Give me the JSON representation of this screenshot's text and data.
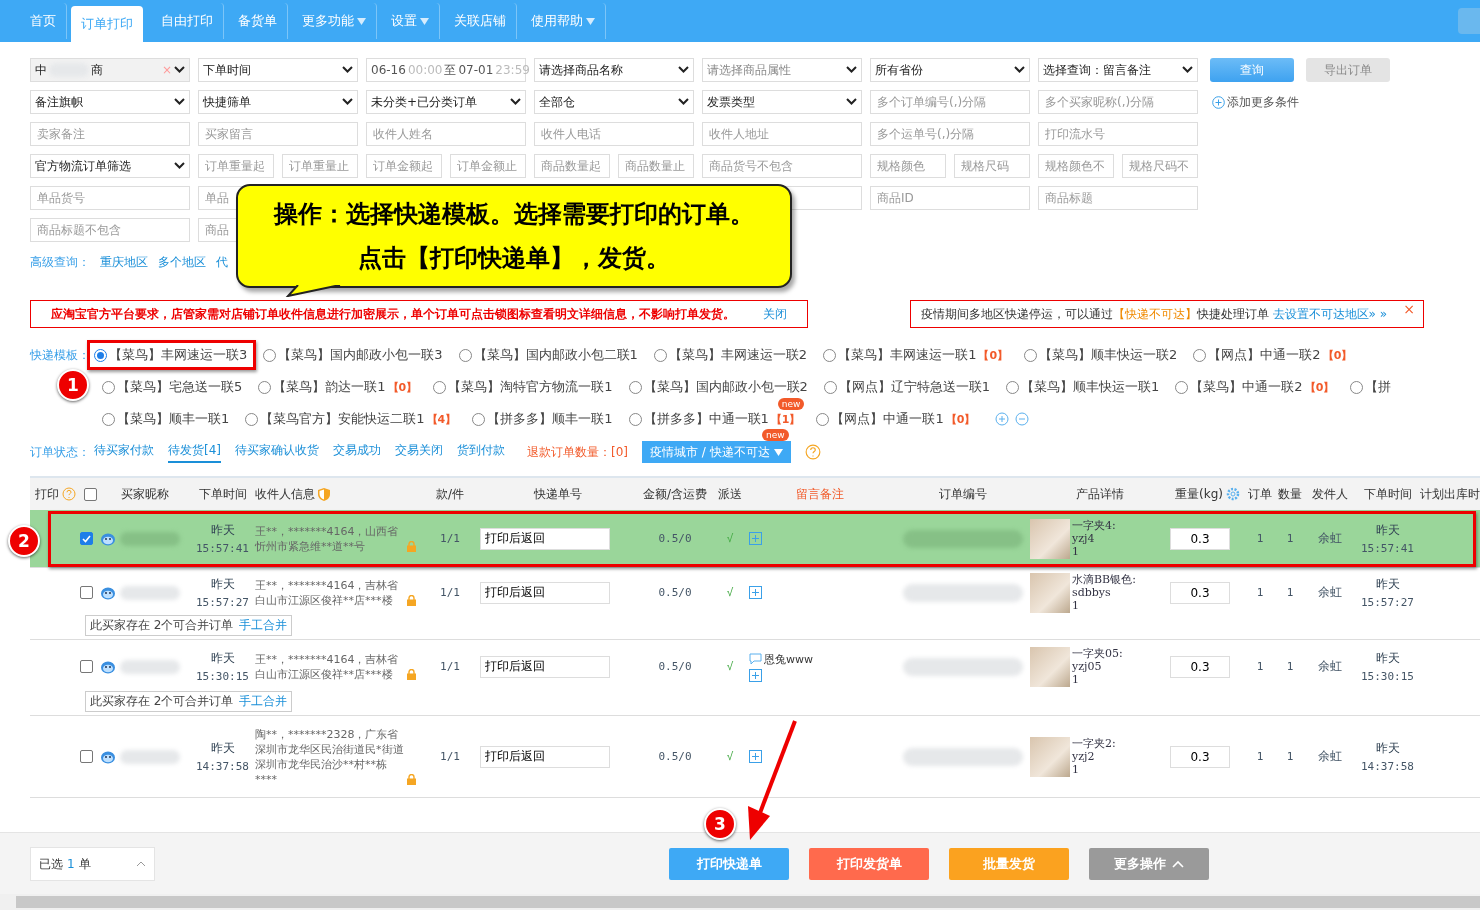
{
  "nav": {
    "tabs": [
      {
        "label": "首页",
        "selected": false,
        "dropdown": false
      },
      {
        "label": "订单打印",
        "selected": true,
        "dropdown": false
      },
      {
        "label": "自由打印",
        "selected": false,
        "dropdown": false
      },
      {
        "label": "备货单",
        "selected": false,
        "dropdown": false
      },
      {
        "label": "更多功能",
        "selected": false,
        "dropdown": true
      },
      {
        "label": "设置",
        "selected": false,
        "dropdown": true
      },
      {
        "label": "关联店铺",
        "selected": false,
        "dropdown": false
      },
      {
        "label": "使用帮助",
        "selected": false,
        "dropdown": true
      }
    ]
  },
  "filters": {
    "rows": [
      [
        {
          "kind": "shop",
          "prefix": "中",
          "suffix": "商",
          "clear": "×"
        },
        {
          "kind": "select",
          "value": "下单时间"
        },
        {
          "kind": "daterange",
          "start_date": "06-16",
          "start_time": "00:00",
          "sep": "至",
          "end_date": "07-01",
          "end_time": "23:59"
        },
        {
          "kind": "select",
          "value": "请选择商品名称"
        },
        {
          "kind": "select",
          "placeholder": "请选择商品属性"
        },
        {
          "kind": "select",
          "value": "所有省份"
        },
        {
          "kind": "select",
          "value": "选择查询：留言备注"
        }
      ],
      [
        {
          "kind": "select",
          "value": "备注旗帜"
        },
        {
          "kind": "select",
          "value": "快捷筛单"
        },
        {
          "kind": "select",
          "value": "未分类+已分类订单"
        },
        {
          "kind": "select",
          "value": "全部仓"
        },
        {
          "kind": "select",
          "value": "发票类型"
        },
        {
          "kind": "input",
          "placeholder": "多个订单编号(,)分隔"
        },
        {
          "kind": "input",
          "placeholder": "多个买家昵称(,)分隔"
        }
      ],
      [
        {
          "kind": "input",
          "placeholder": "卖家备注"
        },
        {
          "kind": "input",
          "placeholder": "买家留言"
        },
        {
          "kind": "input",
          "placeholder": "收件人姓名"
        },
        {
          "kind": "input",
          "placeholder": "收件人电话"
        },
        {
          "kind": "input",
          "placeholder": "收件人地址"
        },
        {
          "kind": "input",
          "placeholder": "多个运单号(,)分隔"
        },
        {
          "kind": "input",
          "placeholder": "打印流水号"
        }
      ],
      [
        {
          "kind": "select",
          "value": "官方物流订单筛选"
        },
        {
          "kind": "range",
          "fields": [
            {
              "placeholder": "订单重量起"
            },
            {
              "placeholder": "订单重量止"
            }
          ]
        },
        {
          "kind": "range",
          "fields": [
            {
              "placeholder": "订单金额起"
            },
            {
              "placeholder": "订单金额止"
            }
          ]
        },
        {
          "kind": "range",
          "fields": [
            {
              "placeholder": "商品数量起"
            },
            {
              "placeholder": "商品数量止"
            }
          ]
        },
        {
          "kind": "input",
          "placeholder": "商品货号不包含"
        },
        {
          "kind": "range",
          "fields": [
            {
              "placeholder": "规格颜色"
            },
            {
              "placeholder": "规格尺码"
            }
          ]
        },
        {
          "kind": "range",
          "fields": [
            {
              "placeholder": "规格颜色不"
            },
            {
              "placeholder": "规格尺码不"
            }
          ]
        }
      ],
      [
        {
          "kind": "input",
          "placeholder": "单品货号"
        },
        {
          "kind": "input",
          "placeholder": "单品"
        },
        {
          "kind": "input"
        },
        {
          "kind": "input"
        },
        {
          "kind": "input"
        },
        {
          "kind": "input",
          "placeholder": "商品ID"
        },
        {
          "kind": "input",
          "placeholder": "商品标题"
        }
      ],
      [
        {
          "kind": "input",
          "placeholder": "商品标题不包含"
        },
        {
          "kind": "input",
          "placeholder": "商品"
        }
      ]
    ],
    "query_button": "查询",
    "export_button": {
      "label": "导出订单",
      "disabled": true
    },
    "add_condition": "添加更多条件",
    "advanced": {
      "label": "高级查询：",
      "links": [
        "重庆地区",
        "多个地区",
        "代"
      ]
    }
  },
  "callout": {
    "line1": "操作：选择快递模板。选择需要打印的订单。",
    "line2": "点击【打印快递单】，发货。"
  },
  "notice": {
    "text": "应淘宝官方平台要求，店管家需对店铺订单收件信息进行加密展示，单个订单可点击锁图标查看明文详细信息，不影响打单发货。",
    "link": "关闭"
  },
  "notice2": {
    "before": "疫情期间多地区快递停运，可以通过",
    "highlight": "【快递不可达】",
    "after": "快捷处理订单",
    "link": "去设置不可达地区» »",
    "close": "×"
  },
  "templates": {
    "label": "快递模板：",
    "rows": [
      [
        {
          "label": "【菜鸟】丰网速运一联3",
          "selected": true
        },
        {
          "label": "【菜鸟】国内邮政小包一联3",
          "selected": false
        },
        {
          "label": "【菜鸟】国内邮政小包二联1",
          "selected": false
        },
        {
          "label": "【菜鸟】丰网速运一联2",
          "selected": false
        },
        {
          "label": "【菜鸟】丰网速运一联1",
          "count": "【0】",
          "selected": false
        },
        {
          "label": "【菜鸟】顺丰快运一联2",
          "selected": false
        },
        {
          "label": "【网点】中通一联2",
          "count": "【0】",
          "selected": false
        }
      ],
      [
        {
          "label": "【菜鸟】宅急送一联5",
          "selected": false
        },
        {
          "label": "【菜鸟】韵达一联1",
          "count": "【0】",
          "selected": false
        },
        {
          "label": "【菜鸟】淘特官方物流一联1",
          "selected": false
        },
        {
          "label": "【菜鸟】国内邮政小包一联2",
          "selected": false
        },
        {
          "label": "【网点】辽宁特急送一联1",
          "selected": false
        },
        {
          "label": "【菜鸟】顺丰快运一联1",
          "selected": false
        },
        {
          "label": "【菜鸟】中通一联2",
          "count": "【0】",
          "selected": false
        },
        {
          "label": "【拼",
          "selected": false
        }
      ],
      [
        {
          "label": "【菜鸟】顺丰一联1",
          "selected": false
        },
        {
          "label": "【菜鸟官方】安能快运二联1",
          "count": "【4】",
          "selected": false
        },
        {
          "label": "【拼多多】顺丰一联1",
          "selected": false
        },
        {
          "label": "【拼多多】中通一联1",
          "count": "【1】",
          "badge": "new",
          "selected": false
        },
        {
          "label": "【网点】中通一联1",
          "count": "【0】",
          "selected": false
        }
      ]
    ]
  },
  "status": {
    "label": "订单状态：",
    "tabs": [
      {
        "label": "待买家付款",
        "selected": false
      },
      {
        "label": "待发货[4]",
        "selected": true
      },
      {
        "label": "待买家确认收货",
        "selected": false
      },
      {
        "label": "交易成功",
        "selected": false
      },
      {
        "label": "交易关闭",
        "selected": false
      },
      {
        "label": "货到付款",
        "selected": false
      }
    ],
    "refund": "退款订单数量：[0]",
    "button": "疫情城市 / 快递不可达",
    "badge": "new"
  },
  "table": {
    "select_all": {
      "checked": false
    },
    "columns": [
      "打印",
      "买家昵称",
      "下单时间",
      "收件人信息",
      "款/件",
      "快递单号",
      "金额/含运费",
      "派送",
      "留言备注",
      "订单编号",
      "产品详情",
      "重量(kg)",
      "订单",
      "数量",
      "发件人",
      "下单时间",
      "计划出库时"
    ],
    "rows": [
      {
        "selected": true,
        "day": "昨天",
        "time": "15:57:41",
        "recipient": "王**，*******4164，山西省忻州市紧急维**道**号",
        "items": "1/1",
        "waybill": "打印后返回",
        "amount": "0.5/0",
        "delivery": "√",
        "product": {
          "name": "一字夹4:",
          "sku": "yzj4",
          "qty": "1"
        },
        "weight": "0.3",
        "orders": "1",
        "quantity": "1",
        "sender": "余虹",
        "created_day": "昨天",
        "created_time": "15:57:41"
      },
      {
        "selected": false,
        "day": "昨天",
        "time": "15:57:27",
        "recipient": "王**，*******4164，吉林省白山市江源区俊祥**店***楼",
        "items": "1/1",
        "waybill": "打印后返回",
        "amount": "0.5/0",
        "delivery": "√",
        "product": {
          "name": "水滴BB银色:",
          "sku": "sdbbys",
          "qty": "1"
        },
        "weight": "0.3",
        "orders": "1",
        "quantity": "1",
        "sender": "余虹",
        "created_day": "昨天",
        "created_time": "15:57:27",
        "merge": {
          "text": "此买家存在 2个可合并订单",
          "link": "手工合并"
        }
      },
      {
        "selected": false,
        "day": "昨天",
        "time": "15:30:15",
        "recipient": "王**，*******4164，吉林省白山市江源区俊祥**店***楼",
        "items": "1/1",
        "waybill": "打印后返回",
        "amount": "0.5/0",
        "delivery": "√",
        "memo": "恩兔www",
        "product": {
          "name": "一字夹05:",
          "sku": "yzj05",
          "qty": "1"
        },
        "weight": "0.3",
        "orders": "1",
        "quantity": "1",
        "sender": "余虹",
        "created_day": "昨天",
        "created_time": "15:30:15",
        "merge": {
          "text": "此买家存在 2个可合并订单",
          "link": "手工合并"
        }
      },
      {
        "selected": false,
        "day": "昨天",
        "time": "14:37:58",
        "recipient": "陶**，*******2328，广东省深圳市龙华区民治街道民*街道深圳市龙华民治沙**村**栋****",
        "items": "1/1",
        "waybill": "打印后返回",
        "amount": "0.5/0",
        "delivery": "√",
        "product": {
          "name": "一字夹2:",
          "sku": "yzj2",
          "qty": "1"
        },
        "weight": "0.3",
        "orders": "1",
        "quantity": "1",
        "sender": "余虹",
        "created_day": "昨天",
        "created_time": "14:37:58"
      }
    ]
  },
  "bottom": {
    "selected_label": "已选",
    "selected_count": "1",
    "selected_unit": "单",
    "buttons": [
      {
        "label": "打印快递单",
        "kind": "primary"
      },
      {
        "label": "打印发货单",
        "kind": "danger"
      },
      {
        "label": "批量发货",
        "kind": "warning"
      },
      {
        "label": "更多操作",
        "kind": "more"
      }
    ]
  },
  "markers": [
    "1",
    "2",
    "3"
  ]
}
